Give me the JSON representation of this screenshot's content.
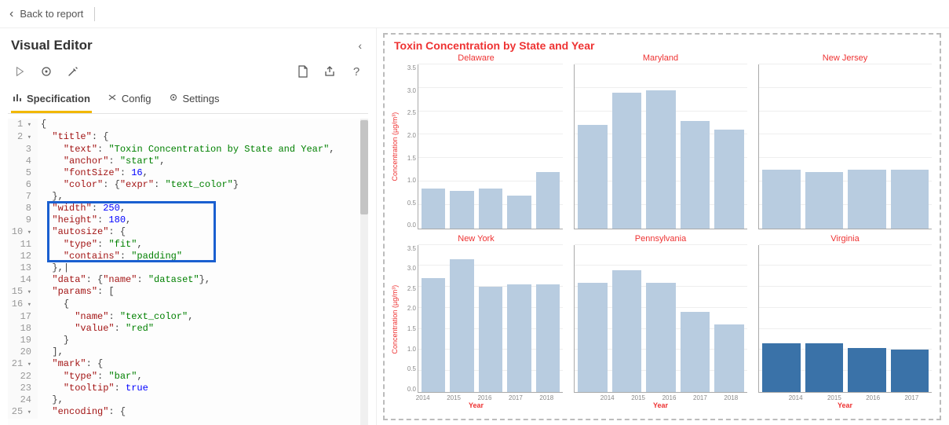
{
  "topbar": {
    "back_label": "Back to report"
  },
  "editor": {
    "title": "Visual Editor",
    "tabs": {
      "specification": "Specification",
      "config": "Config",
      "settings": "Settings"
    }
  },
  "chart_title": "Toxin Concentration by State and Year",
  "y_axis_label": "Concentration (µg/m³)",
  "x_axis_label": "Year",
  "y_ticks": [
    "3.5",
    "3.0",
    "2.5",
    "2.0",
    "1.5",
    "1.0",
    "0.5",
    "0.0"
  ],
  "x_ticks5": [
    "2014",
    "2015",
    "2016",
    "2017",
    "2018"
  ],
  "x_ticks4": [
    "2014",
    "2015",
    "2016",
    "2017"
  ],
  "facets": {
    "delaware": "Delaware",
    "maryland": "Maryland",
    "newjersey": "New Jersey",
    "newyork": "New York",
    "pennsylvania": "Pennsylvania",
    "virginia": "Virginia"
  },
  "code_lines": [
    {
      "n": "1",
      "fold": true,
      "txt": "{"
    },
    {
      "n": "2",
      "fold": true,
      "txt": "  \"title\": {"
    },
    {
      "n": "3",
      "txt": "    \"text\": \"Toxin Concentration by State and Year\","
    },
    {
      "n": "4",
      "txt": "    \"anchor\": \"start\","
    },
    {
      "n": "5",
      "txt": "    \"fontSize\": 16,"
    },
    {
      "n": "6",
      "txt": "    \"color\": {\"expr\": \"text_color\"}"
    },
    {
      "n": "7",
      "txt": "  },"
    },
    {
      "n": "8",
      "txt": "  \"width\": 250,"
    },
    {
      "n": "9",
      "txt": "  \"height\": 180,"
    },
    {
      "n": "10",
      "fold": true,
      "txt": "  \"autosize\": {"
    },
    {
      "n": "11",
      "txt": "    \"type\": \"fit\","
    },
    {
      "n": "12",
      "txt": "    \"contains\": \"padding\""
    },
    {
      "n": "13",
      "txt": "  },|"
    },
    {
      "n": "14",
      "txt": "  \"data\": {\"name\": \"dataset\"},"
    },
    {
      "n": "15",
      "fold": true,
      "txt": "  \"params\": ["
    },
    {
      "n": "16",
      "fold": true,
      "txt": "    {"
    },
    {
      "n": "17",
      "txt": "      \"name\": \"text_color\","
    },
    {
      "n": "18",
      "txt": "      \"value\": \"red\""
    },
    {
      "n": "19",
      "txt": "    }"
    },
    {
      "n": "20",
      "txt": "  ],"
    },
    {
      "n": "21",
      "fold": true,
      "txt": "  \"mark\": {"
    },
    {
      "n": "22",
      "txt": "    \"type\": \"bar\","
    },
    {
      "n": "23",
      "txt": "    \"tooltip\": true"
    },
    {
      "n": "24",
      "txt": "  },"
    },
    {
      "n": "25",
      "fold": true,
      "txt": "  \"encoding\": {"
    }
  ],
  "chart_data": {
    "type": "bar",
    "title": "Toxin Concentration by State and Year",
    "xlabel": "Year",
    "ylabel": "Concentration (µg/m³)",
    "ylim": [
      0,
      3.5
    ],
    "facets": [
      {
        "name": "Delaware",
        "categories": [
          "2014",
          "2015",
          "2016",
          "2017",
          "2018"
        ],
        "values": [
          0.85,
          0.8,
          0.85,
          0.7,
          1.2
        ]
      },
      {
        "name": "Maryland",
        "categories": [
          "2014",
          "2015",
          "2016",
          "2017",
          "2018"
        ],
        "values": [
          2.2,
          2.9,
          2.95,
          2.3,
          2.1
        ]
      },
      {
        "name": "New Jersey",
        "categories": [
          "2014",
          "2015",
          "2016",
          "2017"
        ],
        "values": [
          1.25,
          1.2,
          1.25,
          1.25
        ]
      },
      {
        "name": "New York",
        "categories": [
          "2014",
          "2015",
          "2016",
          "2017",
          "2018"
        ],
        "values": [
          2.7,
          3.15,
          2.5,
          2.55,
          2.55
        ]
      },
      {
        "name": "Pennsylvania",
        "categories": [
          "2014",
          "2015",
          "2016",
          "2017",
          "2018"
        ],
        "values": [
          2.6,
          2.9,
          2.6,
          1.9,
          1.6
        ]
      },
      {
        "name": "Virginia",
        "categories": [
          "2014",
          "2015",
          "2016",
          "2017"
        ],
        "values": [
          1.15,
          1.15,
          1.05,
          1.0
        ],
        "highlight": true
      }
    ]
  }
}
